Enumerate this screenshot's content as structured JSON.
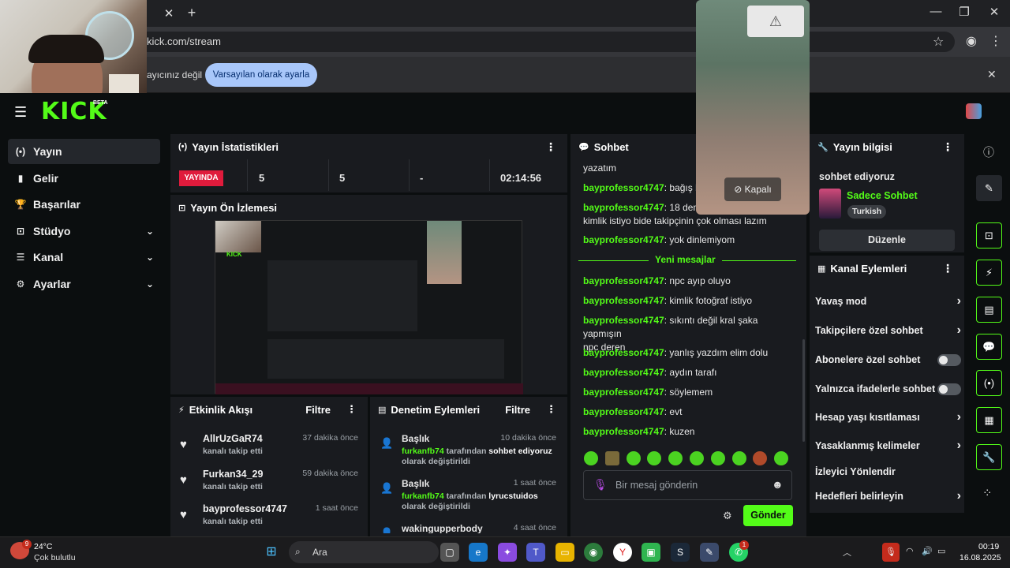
{
  "browser": {
    "url": "kick.com/stream",
    "tab_close": "✕",
    "tab_new": "+",
    "infobar_text": "ayıcınız değil",
    "infobar_button": "Varsayılan olarak ayarla",
    "infobar_close": "✕"
  },
  "floating_video": {
    "off_label": "Kapalı",
    "warning": "⚠"
  },
  "kick": {
    "logo": "KICK",
    "beta": "BETA"
  },
  "nav": {
    "items": [
      {
        "icon": "(•)",
        "label": "Yayın",
        "chevron": ""
      },
      {
        "icon": "▮",
        "label": "Gelir",
        "chevron": ""
      },
      {
        "icon": "🏆",
        "label": "Başarılar",
        "chevron": ""
      },
      {
        "icon": "⊡",
        "label": "Stüdyo",
        "chevron": "⌄"
      },
      {
        "icon": "☰",
        "label": "Kanal",
        "chevron": "⌄"
      },
      {
        "icon": "⚙",
        "label": "Ayarlar",
        "chevron": "⌄"
      }
    ]
  },
  "stats": {
    "title": "Yayın İstatistikleri",
    "live_badge": "YAYINDA",
    "values": [
      "5",
      "5",
      "-",
      "02:14:56"
    ]
  },
  "preview": {
    "title": "Yayın Ön İzlemesi"
  },
  "activity": {
    "title": "Etkinlik Akışı",
    "filter": "Filtre",
    "items": [
      {
        "name": "AllrUzGaR74",
        "sub": "kanalı takip etti",
        "time": "37 dakika önce"
      },
      {
        "name": "Furkan34_29",
        "sub": "kanalı takip etti",
        "time": "59 dakika önce"
      },
      {
        "name": "bayprofessor4747",
        "sub": "kanalı takip etti",
        "time": "1 saat önce"
      }
    ]
  },
  "moderation": {
    "title": "Denetim Eylemleri",
    "filter": "Filtre",
    "items": [
      {
        "title": "Başlık",
        "time": "10 dakika önce",
        "user": "furkanfb74",
        "mid": " tarafından ",
        "value": "sohbet ediyoruz",
        "tail": "olarak değiştirildi"
      },
      {
        "title": "Başlık",
        "time": "1 saat önce",
        "user": "furkanfb74",
        "mid": " tarafından ",
        "value": "lyrucstuidos",
        "tail": "olarak değiştirildi"
      },
      {
        "title": "wakingupperbody",
        "time": "4 saat önce"
      }
    ]
  },
  "chat": {
    "title": "Sohbet",
    "top_fragment": "yazatım",
    "messages_before": [
      {
        "user": "bayprofessor4747",
        "text": ": bağış ba"
      },
      {
        "user": "bayprofessor4747",
        "text": ": 18 den b",
        "text2": "kimlik istiyo bide takipçinin çok olması lazım"
      },
      {
        "user": "bayprofessor4747",
        "text": ": yok dinlemiyom"
      }
    ],
    "new_messages_label": "Yeni mesajlar",
    "messages_after": [
      {
        "user": "bayprofessor4747",
        "text": ": npc ayıp oluyo"
      },
      {
        "user": "bayprofessor4747",
        "text": ": kimlik fotoğraf istiyo"
      },
      {
        "user": "bayprofessor4747",
        "text": ": sıkıntı değil kral şaka yapmışın",
        "text2": "npc deren"
      },
      {
        "user": "bayprofessor4747",
        "text": ": yanlış yazdım elim dolu"
      },
      {
        "user": "bayprofessor4747",
        "text": ": aydın tarafı"
      },
      {
        "user": "bayprofessor4747",
        "text": ": söylemem"
      },
      {
        "user": "bayprofessor4747",
        "text": ": evt"
      },
      {
        "user": "bayprofessor4747",
        "text": ": kuzen"
      }
    ],
    "input_placeholder": "Bir mesaj gönderin",
    "send_label": "Gönder"
  },
  "stream_info": {
    "title": "Yayın bilgisi",
    "stream_title": "sohbet ediyoruz",
    "category": "Sadece Sohbet",
    "language": "Turkish",
    "edit_label": "Düzenle"
  },
  "channel_actions": {
    "title": "Kanal Eylemleri",
    "items": [
      {
        "label": "Yavaş mod",
        "control": "chevron"
      },
      {
        "label": "Takipçilere özel sohbet",
        "control": "chevron"
      },
      {
        "label": "Abonelere özel sohbet",
        "control": "toggle"
      },
      {
        "label": "Yalnızca ifadelerle sohbet",
        "control": "toggle"
      },
      {
        "label": "Hesap yaşı kısıtlaması",
        "control": "chevron"
      },
      {
        "label": "Yasaklanmış kelimeler",
        "control": "chevron"
      },
      {
        "label": "İzleyici Yönlendir",
        "control": "none"
      },
      {
        "label": "Hedefleri belirleyin",
        "control": "chevron"
      }
    ]
  },
  "taskbar": {
    "weather_temp": "24°C",
    "weather_desc": "Çok bulutlu",
    "weather_badge": "9",
    "search_label": "Ara",
    "time": "00:19",
    "date": "16.08.2025",
    "whatsapp_badge": "1"
  },
  "colors": {
    "accent": "#53fc18",
    "live": "#e01b3c",
    "panel": "#191b1f"
  }
}
